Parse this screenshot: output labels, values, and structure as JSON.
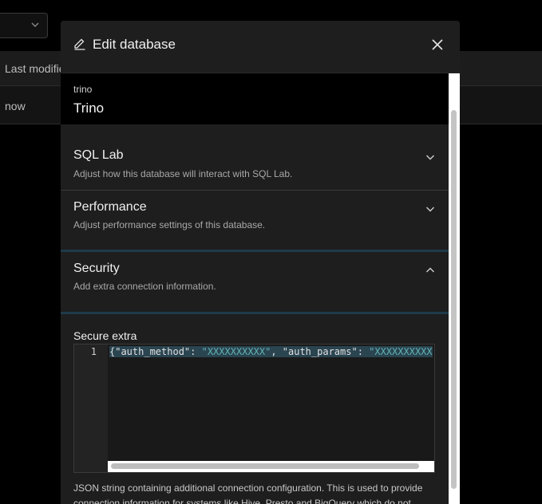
{
  "background": {
    "column_header": "Last modified",
    "row_value": "now"
  },
  "modal": {
    "title": "Edit database",
    "engine": "trino",
    "database_name": "Trino",
    "panels": {
      "sql_lab": {
        "title": "SQL Lab",
        "subtitle": "Adjust how this database will interact with SQL Lab."
      },
      "performance": {
        "title": "Performance",
        "subtitle": "Adjust performance settings of this database."
      },
      "security": {
        "title": "Security",
        "subtitle": "Add extra connection information."
      }
    },
    "secure_extra": {
      "label": "Secure extra",
      "line_number": "1",
      "code_key1": "\"auth_method\"",
      "code_val1": "\"XXXXXXXXXX\"",
      "code_key2": "\"auth_params\"",
      "code_val2": "\"XXXXXXXXXX",
      "help": "JSON string containing additional connection configuration. This is used to provide connection information for systems like Hive, Presto and BigQuery which do not conform to the username:password syntax normally used by SQLAlchemy."
    }
  },
  "icons": {
    "edit": "pencil-icon",
    "close": "close-icon",
    "expand": "chevron-down-icon",
    "collapse": "chevron-up-icon"
  }
}
